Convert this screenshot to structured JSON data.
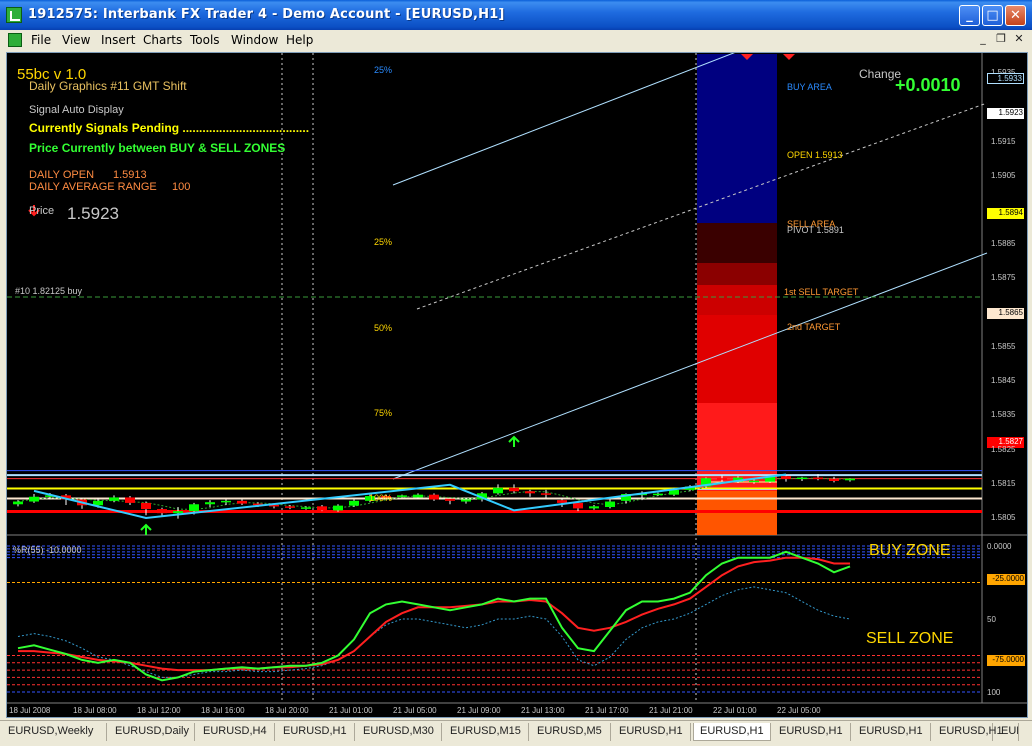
{
  "window": {
    "title": "1912575: Interbank FX Trader 4 - Demo Account - [EURUSD,H1]",
    "min_label": "_",
    "max_label": "□",
    "close_label": "✕",
    "child_min": "_",
    "child_restore": "❐",
    "child_close": "✕"
  },
  "menu": [
    "File",
    "View",
    "Insert",
    "Charts",
    "Tools",
    "Window",
    "Help"
  ],
  "indicator": {
    "name": "55bc v 1.0",
    "graphics": "Daily Graphics #11 GMT Shift",
    "signal": "Signal Auto Display",
    "pending": "Currently Signals Pending ......................................",
    "between": "Price Currently between BUY & SELL ZONES",
    "daily_open_label": "DAILY OPEN",
    "daily_open_value": "1.5913",
    "dar_label": "DAILY AVERAGE RANGE",
    "dar_value": "100",
    "price_label": "Price",
    "price_value": "1.5923",
    "change_label": "Change",
    "change_value": "+0.0010",
    "order_label": "#10 1.82125 buy"
  },
  "annotations": {
    "fib_25_top": "25%",
    "fib_25": "25%",
    "fib_50": "50%",
    "fib_75": "75%",
    "fib_100": "100%",
    "buy_area": "BUY AREA",
    "open": "OPEN 1.5913",
    "sell_area": "SELL AREA",
    "pivot": "PIVOT 1.5891",
    "sell_target_1": "1st SELL TARGET",
    "sell_target_2": "2nd TARGET",
    "buy_zone": "BUY ZONE",
    "sell_zone": "SELL ZONE",
    "wpr_label": "%R(55) -10.0000"
  },
  "price_axis": {
    "ticks": [
      "1.5935",
      "1.5915",
      "1.5905",
      "1.5885",
      "1.5875",
      "1.5855",
      "1.5845",
      "1.5835",
      "1.5825",
      "1.5815",
      "1.5805"
    ],
    "box_top": "1.5933",
    "box_bid": "1.5923",
    "box_yellow": "1.5894",
    "box_white": "1.5865",
    "box_red": "1.5827"
  },
  "wpr_axis": {
    "zero": "0.0000",
    "m25": "-25.0000",
    "fifty": "50",
    "m75": "-75.0000",
    "m100": "100"
  },
  "time_axis": [
    "18 Jul 2008",
    "18 Jul 08:00",
    "18 Jul 12:00",
    "18 Jul 16:00",
    "18 Jul 20:00",
    "21 Jul 01:00",
    "21 Jul 05:00",
    "21 Jul 09:00",
    "21 Jul 13:00",
    "21 Jul 17:00",
    "21 Jul 21:00",
    "22 Jul 01:00",
    "22 Jul 05:00"
  ],
  "tabs": [
    "EURUSD,Weekly",
    "EURUSD,Daily",
    "EURUSD,H4",
    "EURUSD,H1",
    "EURUSD,M30",
    "EURUSD,M15",
    "EURUSD,M5",
    "EURUSD,H1",
    "EURUSD,H1",
    "EURUSD,H1",
    "EURUSD,H1",
    "EURUSD,H1",
    "EURUSD,H"
  ],
  "colors": {
    "bull": "#00ff00",
    "bear": "#ff0000",
    "zigzag": "#33ccff",
    "yellow_line": "#ffff00",
    "red_line": "#ff0000",
    "buy_area_fill": "#000080"
  },
  "chart_data": {
    "type": "candlestick",
    "symbol": "EURUSD",
    "timeframe": "H1",
    "ylim": [
      1.58,
      1.594
    ],
    "levels": {
      "daily_open": 1.5913,
      "pivot": 1.5891,
      "yellow": 1.5894,
      "white": 1.5865,
      "red": 1.5827,
      "bid": 1.5923,
      "top": 1.5933
    },
    "candles": [
      {
        "o": 1.5848,
        "c": 1.5856,
        "h": 1.586,
        "l": 1.5842
      },
      {
        "o": 1.5856,
        "c": 1.587,
        "h": 1.5878,
        "l": 1.5852
      },
      {
        "o": 1.587,
        "c": 1.5874,
        "h": 1.5881,
        "l": 1.5862
      },
      {
        "o": 1.5874,
        "c": 1.5862,
        "h": 1.5878,
        "l": 1.5846
      },
      {
        "o": 1.5862,
        "c": 1.5845,
        "h": 1.5866,
        "l": 1.5835
      },
      {
        "o": 1.5845,
        "c": 1.5858,
        "h": 1.5866,
        "l": 1.5838
      },
      {
        "o": 1.5858,
        "c": 1.5868,
        "h": 1.5874,
        "l": 1.5854
      },
      {
        "o": 1.5868,
        "c": 1.5852,
        "h": 1.5872,
        "l": 1.5846
      },
      {
        "o": 1.5852,
        "c": 1.5834,
        "h": 1.5856,
        "l": 1.5816
      },
      {
        "o": 1.5834,
        "c": 1.5822,
        "h": 1.5838,
        "l": 1.5814
      },
      {
        "o": 1.5822,
        "c": 1.5828,
        "h": 1.584,
        "l": 1.5806
      },
      {
        "o": 1.5828,
        "c": 1.5848,
        "h": 1.5852,
        "l": 1.5818
      },
      {
        "o": 1.5848,
        "c": 1.5854,
        "h": 1.586,
        "l": 1.584
      },
      {
        "o": 1.5854,
        "c": 1.5858,
        "h": 1.5862,
        "l": 1.5846
      },
      {
        "o": 1.5858,
        "c": 1.585,
        "h": 1.5862,
        "l": 1.5846
      },
      {
        "o": 1.585,
        "c": 1.5846,
        "h": 1.5854,
        "l": 1.584
      },
      {
        "o": 1.5846,
        "c": 1.5842,
        "h": 1.5848,
        "l": 1.5836
      },
      {
        "o": 1.5842,
        "c": 1.5838,
        "h": 1.5846,
        "l": 1.5834
      },
      {
        "o": 1.5838,
        "c": 1.5839,
        "h": 1.5842,
        "l": 1.5832
      },
      {
        "o": 1.5842,
        "c": 1.583,
        "h": 1.5846,
        "l": 1.5828
      },
      {
        "o": 1.583,
        "c": 1.5844,
        "h": 1.5848,
        "l": 1.5826
      },
      {
        "o": 1.5844,
        "c": 1.5858,
        "h": 1.5862,
        "l": 1.584
      },
      {
        "o": 1.5858,
        "c": 1.5872,
        "h": 1.5876,
        "l": 1.5854
      },
      {
        "o": 1.5872,
        "c": 1.587,
        "h": 1.5876,
        "l": 1.5866
      },
      {
        "o": 1.5872,
        "c": 1.5874,
        "h": 1.5876,
        "l": 1.5868
      },
      {
        "o": 1.5868,
        "c": 1.5876,
        "h": 1.588,
        "l": 1.5864
      },
      {
        "o": 1.5876,
        "c": 1.5862,
        "h": 1.588,
        "l": 1.5858
      },
      {
        "o": 1.5864,
        "c": 1.5858,
        "h": 1.5866,
        "l": 1.5848
      },
      {
        "o": 1.5856,
        "c": 1.5862,
        "h": 1.5866,
        "l": 1.585
      },
      {
        "o": 1.5862,
        "c": 1.588,
        "h": 1.5884,
        "l": 1.5856
      },
      {
        "o": 1.588,
        "c": 1.5896,
        "h": 1.5906,
        "l": 1.5876
      },
      {
        "o": 1.5896,
        "c": 1.5886,
        "h": 1.5906,
        "l": 1.588
      },
      {
        "o": 1.5886,
        "c": 1.588,
        "h": 1.589,
        "l": 1.587
      },
      {
        "o": 1.588,
        "c": 1.5876,
        "h": 1.589,
        "l": 1.5866
      },
      {
        "o": 1.586,
        "c": 1.5852,
        "h": 1.5866,
        "l": 1.584
      },
      {
        "o": 1.5852,
        "c": 1.5836,
        "h": 1.5856,
        "l": 1.5828
      },
      {
        "o": 1.5836,
        "c": 1.5842,
        "h": 1.5846,
        "l": 1.5832
      },
      {
        "o": 1.584,
        "c": 1.5856,
        "h": 1.5862,
        "l": 1.5836
      },
      {
        "o": 1.5858,
        "c": 1.5878,
        "h": 1.588,
        "l": 1.585
      },
      {
        "o": 1.5878,
        "c": 1.5879,
        "h": 1.5886,
        "l": 1.586
      },
      {
        "o": 1.5878,
        "c": 1.5879,
        "h": 1.5882,
        "l": 1.5872
      },
      {
        "o": 1.5876,
        "c": 1.589,
        "h": 1.5896,
        "l": 1.5872
      },
      {
        "o": 1.589,
        "c": 1.59,
        "h": 1.5904,
        "l": 1.5886
      },
      {
        "o": 1.59,
        "c": 1.5924,
        "h": 1.5926,
        "l": 1.5896
      },
      {
        "o": 1.5924,
        "c": 1.592,
        "h": 1.5932,
        "l": 1.5914
      },
      {
        "o": 1.5914,
        "c": 1.5926,
        "h": 1.593,
        "l": 1.591
      },
      {
        "o": 1.5916,
        "c": 1.5917,
        "h": 1.5922,
        "l": 1.5908
      },
      {
        "o": 1.5914,
        "c": 1.5928,
        "h": 1.5932,
        "l": 1.591
      },
      {
        "o": 1.593,
        "c": 1.5922,
        "h": 1.5932,
        "l": 1.5914
      },
      {
        "o": 1.5924,
        "c": 1.5926,
        "h": 1.5928,
        "l": 1.5916
      },
      {
        "o": 1.5926,
        "c": 1.5922,
        "h": 1.5936,
        "l": 1.5918
      },
      {
        "o": 1.5922,
        "c": 1.5916,
        "h": 1.5928,
        "l": 1.5912
      },
      {
        "o": 1.5918,
        "c": 1.5923,
        "h": 1.5924,
        "l": 1.5914
      }
    ],
    "zigzag": [
      [
        1,
        1.5887
      ],
      [
        8,
        1.5808
      ],
      [
        27,
        1.5905
      ],
      [
        31,
        1.583
      ]
    ],
    "wpr": {
      "label": "%R(55)",
      "current": -10.0,
      "ylim": [
        -100,
        0
      ],
      "green": [
        -70,
        -68,
        -71,
        -74,
        -78,
        -80,
        -78,
        -80,
        -88,
        -92,
        -90,
        -86,
        -85,
        -84,
        -83,
        -84,
        -83,
        -82,
        -82,
        -80,
        -75,
        -64,
        -46,
        -40,
        -38,
        -40,
        -42,
        -44,
        -42,
        -40,
        -36,
        -38,
        -36,
        -36,
        -56,
        -70,
        -72,
        -58,
        -44,
        -38,
        -38,
        -36,
        -32,
        -20,
        -12,
        -8,
        -8,
        -8,
        -4,
        -8,
        -12,
        -18,
        -14
      ],
      "red": [
        -72,
        -72,
        -73,
        -74,
        -76,
        -78,
        -79,
        -80,
        -82,
        -84,
        -85,
        -85,
        -85,
        -84,
        -84,
        -84,
        -83,
        -83,
        -82,
        -81,
        -78,
        -72,
        -62,
        -52,
        -46,
        -42,
        -42,
        -42,
        -41,
        -40,
        -38,
        -38,
        -37,
        -38,
        -46,
        -56,
        -58,
        -56,
        -52,
        -47,
        -43,
        -40,
        -36,
        -28,
        -20,
        -14,
        -11,
        -10,
        -8,
        -8,
        -9,
        -12,
        -12
      ],
      "cyan": [
        -62,
        -60,
        -62,
        -65,
        -70,
        -76,
        -78,
        -82,
        -86,
        -90,
        -90,
        -88,
        -86,
        -86,
        -85,
        -86,
        -86,
        -85,
        -84,
        -82,
        -78,
        -72,
        -62,
        -54,
        -50,
        -50,
        -52,
        -54,
        -56,
        -54,
        -50,
        -50,
        -48,
        -50,
        -62,
        -78,
        -82,
        -76,
        -64,
        -56,
        -52,
        -50,
        -46,
        -40,
        -34,
        -30,
        -28,
        -30,
        -32,
        -38,
        -44,
        -48,
        -50
      ]
    }
  }
}
